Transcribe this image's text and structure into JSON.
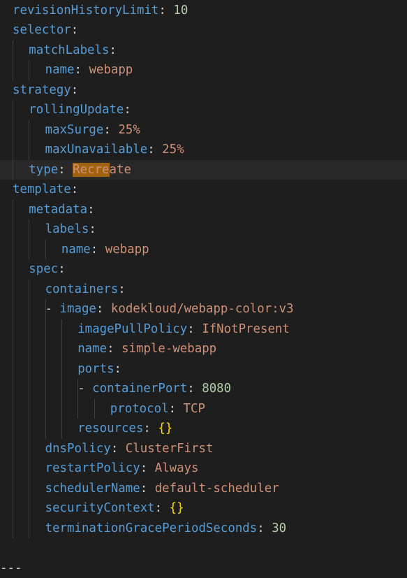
{
  "colors": {
    "background": "#1e1e1e",
    "current_line": "#282828",
    "key": "#569cd6",
    "string": "#ce9178",
    "number": "#b5cea8",
    "brace": "#ffd700",
    "punctuation": "#d4d4d4",
    "find_highlight": "#a0620c",
    "indent_guide": "#404040"
  },
  "lines": [
    {
      "indent": 0,
      "key": "revisionHistoryLimit",
      "value": "10",
      "vtype": "num"
    },
    {
      "indent": 0,
      "key": "selector",
      "value": "",
      "vtype": ""
    },
    {
      "indent": 1,
      "key": "matchLabels",
      "value": "",
      "vtype": ""
    },
    {
      "indent": 2,
      "key": "name",
      "value": "webapp",
      "vtype": "str"
    },
    {
      "indent": 0,
      "key": "strategy",
      "value": "",
      "vtype": ""
    },
    {
      "indent": 1,
      "key": "rollingUpdate",
      "value": "",
      "vtype": ""
    },
    {
      "indent": 2,
      "key": "maxSurge",
      "value": "25%",
      "vtype": "str"
    },
    {
      "indent": 2,
      "key": "maxUnavailable",
      "value": "25%",
      "vtype": "str"
    },
    {
      "indent": 1,
      "key": "type",
      "value": "Recreate",
      "vtype": "str",
      "current": true,
      "highlight": "Recre"
    },
    {
      "indent": 0,
      "key": "template",
      "value": "",
      "vtype": ""
    },
    {
      "indent": 1,
      "key": "metadata",
      "value": "",
      "vtype": ""
    },
    {
      "indent": 2,
      "key": "labels",
      "value": "",
      "vtype": ""
    },
    {
      "indent": 3,
      "key": "name",
      "value": "webapp",
      "vtype": "str"
    },
    {
      "indent": 1,
      "key": "spec",
      "value": "",
      "vtype": ""
    },
    {
      "indent": 2,
      "key": "containers",
      "value": "",
      "vtype": ""
    },
    {
      "indent": 3,
      "dash": true,
      "key": "image",
      "value": "kodekloud/webapp-color:v3",
      "vtype": "str"
    },
    {
      "indent": 4,
      "key": "imagePullPolicy",
      "value": "IfNotPresent",
      "vtype": "str"
    },
    {
      "indent": 4,
      "key": "name",
      "value": "simple-webapp",
      "vtype": "str"
    },
    {
      "indent": 4,
      "key": "ports",
      "value": "",
      "vtype": ""
    },
    {
      "indent": 5,
      "dash": true,
      "key": "containerPort",
      "value": "8080",
      "vtype": "num"
    },
    {
      "indent": 6,
      "key": "protocol",
      "value": "TCP",
      "vtype": "str"
    },
    {
      "indent": 4,
      "key": "resources",
      "value": "{}",
      "vtype": "brace"
    },
    {
      "indent": 2,
      "key": "dnsPolicy",
      "value": "ClusterFirst",
      "vtype": "str"
    },
    {
      "indent": 2,
      "key": "restartPolicy",
      "value": "Always",
      "vtype": "str"
    },
    {
      "indent": 2,
      "key": "schedulerName",
      "value": "default-scheduler",
      "vtype": "str"
    },
    {
      "indent": 2,
      "key": "securityContext",
      "value": "{}",
      "vtype": "brace"
    },
    {
      "indent": 2,
      "key": "terminationGracePeriodSeconds",
      "value": "30",
      "vtype": "num"
    },
    {
      "indent": 0,
      "key": "",
      "value": "",
      "vtype": "",
      "blank": true
    },
    {
      "indent": 0,
      "key": "",
      "value": "",
      "vtype": "",
      "separator": "---"
    }
  ]
}
